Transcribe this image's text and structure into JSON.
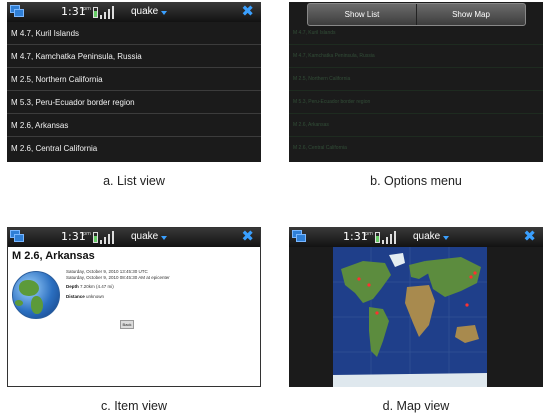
{
  "status_bar": {
    "time": "1:31",
    "ampm_top": "pm",
    "ampm_bottom": "",
    "app_title": "quake",
    "close_glyph": "✖",
    "icons": [
      "task-switcher-icon",
      "battery-icon",
      "signal-icon",
      "dropdown-caret-icon",
      "close-icon"
    ]
  },
  "list_view": {
    "caption": "a. List view",
    "items": [
      "M 4.7, Kuril Islands",
      "M 4.7, Kamchatka Peninsula, Russia",
      "M 2.5, Northern California",
      "M 5.3, Peru-Ecuador border region",
      "M 2.6, Arkansas",
      "M 2.6, Central California"
    ]
  },
  "options_menu": {
    "caption": "b. Options menu",
    "buttons": [
      "Show List",
      "Show Map"
    ]
  },
  "item_view": {
    "caption": "c. Item view",
    "title": "M 2.6, Arkansas",
    "utc_line": "Saturday, October 9, 2010 13:45:30 UTC",
    "epicenter_line": "Saturday, October 9, 2010 08:45:30 AM at epicenter",
    "depth_label": "Depth",
    "depth_value": "7.20km (4.47 mi)",
    "distance_label": "Distance",
    "distance_value": "unknown",
    "back_label": "Back"
  },
  "map_view": {
    "caption": "d. Map view"
  },
  "colors": {
    "accent": "#3aa0ff",
    "dark_bg": "#1b1b1b",
    "ocean": "#1f3f8a",
    "land": "#5c8c3e",
    "quake_marker": "#ff3030"
  }
}
